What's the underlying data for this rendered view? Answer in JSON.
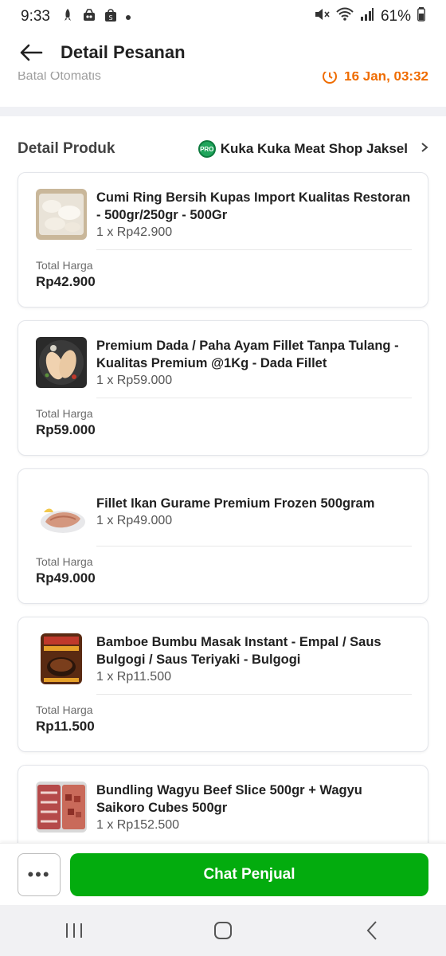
{
  "status_bar": {
    "time": "9:33",
    "battery": "61%"
  },
  "header": {
    "title": "Detail Pesanan"
  },
  "peek": {
    "label": "Batal Otomatis",
    "deadline": "16 Jan, 03:32"
  },
  "section": {
    "title": "Detail Produk",
    "shop_name": "Kuka Kuka Meat Shop Jaksel",
    "badge": "PRO"
  },
  "products": [
    {
      "name": "Cumi Ring Bersih Kupas Import Kualitas Restoran - 500gr/250gr - 500Gr",
      "qty": "1 x Rp42.900",
      "total_label": "Total Harga",
      "total": "Rp42.900"
    },
    {
      "name": "Premium Dada / Paha Ayam Fillet Tanpa Tulang - Kualitas Premium @1Kg - Dada Fillet",
      "qty": "1 x Rp59.000",
      "total_label": "Total Harga",
      "total": "Rp59.000"
    },
    {
      "name": "Fillet Ikan Gurame Premium Frozen 500gram",
      "qty": "1 x Rp49.000",
      "total_label": "Total Harga",
      "total": "Rp49.000"
    },
    {
      "name": "Bamboe Bumbu Masak Instant - Empal / Saus Bulgogi / Saus Teriyaki - Bulgogi",
      "qty": "1 x Rp11.500",
      "total_label": "Total Harga",
      "total": "Rp11.500"
    },
    {
      "name": "Bundling Wagyu Beef Slice 500gr + Wagyu Saikoro Cubes 500gr",
      "qty": "1 x Rp152.500",
      "total_label": "Total Harga",
      "total": ""
    }
  ],
  "bottom": {
    "more_label": "•••",
    "chat_label": "Chat Penjual"
  },
  "colors": {
    "primary_green": "#03ac0e",
    "deadline_orange": "#ef6c00"
  }
}
